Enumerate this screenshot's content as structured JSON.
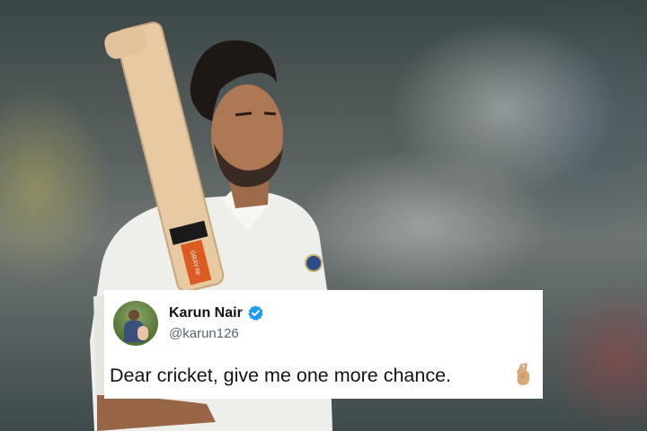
{
  "tweet": {
    "name": "Karun Nair",
    "handle": "@karun126",
    "text": "Dear cricket, give me one more chance.",
    "verified": true,
    "emoji": "crossed-fingers"
  },
  "photo": {
    "bat_sticker_text": "GRAY-NI"
  },
  "colors": {
    "verified_blue": "#1d9bf0",
    "handle_gray": "#536471",
    "text": "#0f1419"
  }
}
